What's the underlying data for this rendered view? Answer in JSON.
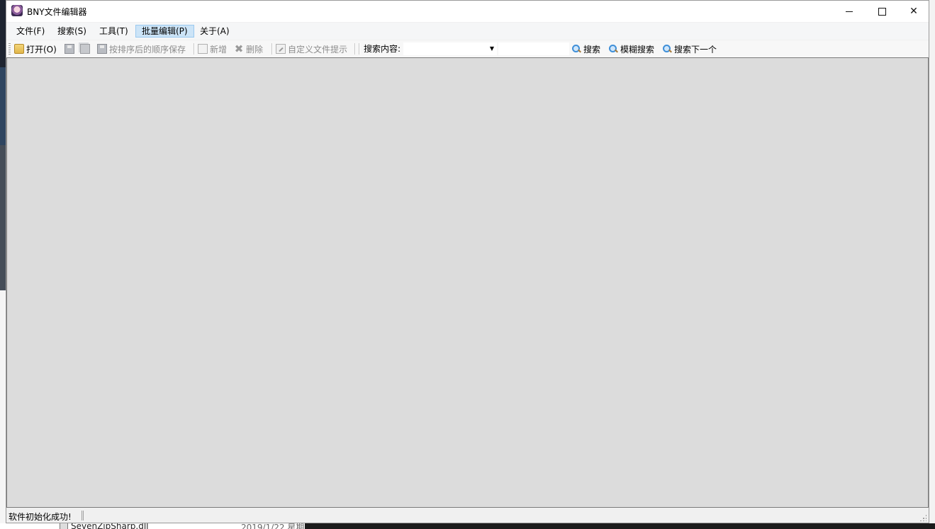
{
  "window": {
    "title": "BNY文件编辑器",
    "app_icon": "anime-avatar-icon",
    "controls": [
      "minimize-icon",
      "maximize-icon",
      "close-icon"
    ]
  },
  "menubar": {
    "items": [
      {
        "label": "文件(F)"
      },
      {
        "label": "搜索(S)"
      },
      {
        "label": "工具(T)"
      },
      {
        "label": "批量编辑(P)",
        "active": true
      },
      {
        "label": "关于(A)"
      }
    ]
  },
  "toolbar": {
    "open_label": "打开(O)",
    "save_sorted_label": "按排序后的顺序保存",
    "new_label": "新增",
    "delete_label": "删除",
    "custom_hint_label": "自定义文件提示",
    "search_content_label": "搜索内容:",
    "search_combo_value": "",
    "search_text_value": "",
    "search_label": "搜索",
    "fuzzy_search_label": "模糊搜索",
    "search_next_label": "搜索下一个"
  },
  "status": {
    "message": "软件初始化成功!"
  },
  "background": {
    "file_name": "SevenZipSharp.dll",
    "file_date": "2019/1/22 星期"
  },
  "colors": {
    "content_bg": "#dcdcdc",
    "menu_active_bg": "#cce4f7",
    "menu_active_border": "#99c9ef"
  }
}
